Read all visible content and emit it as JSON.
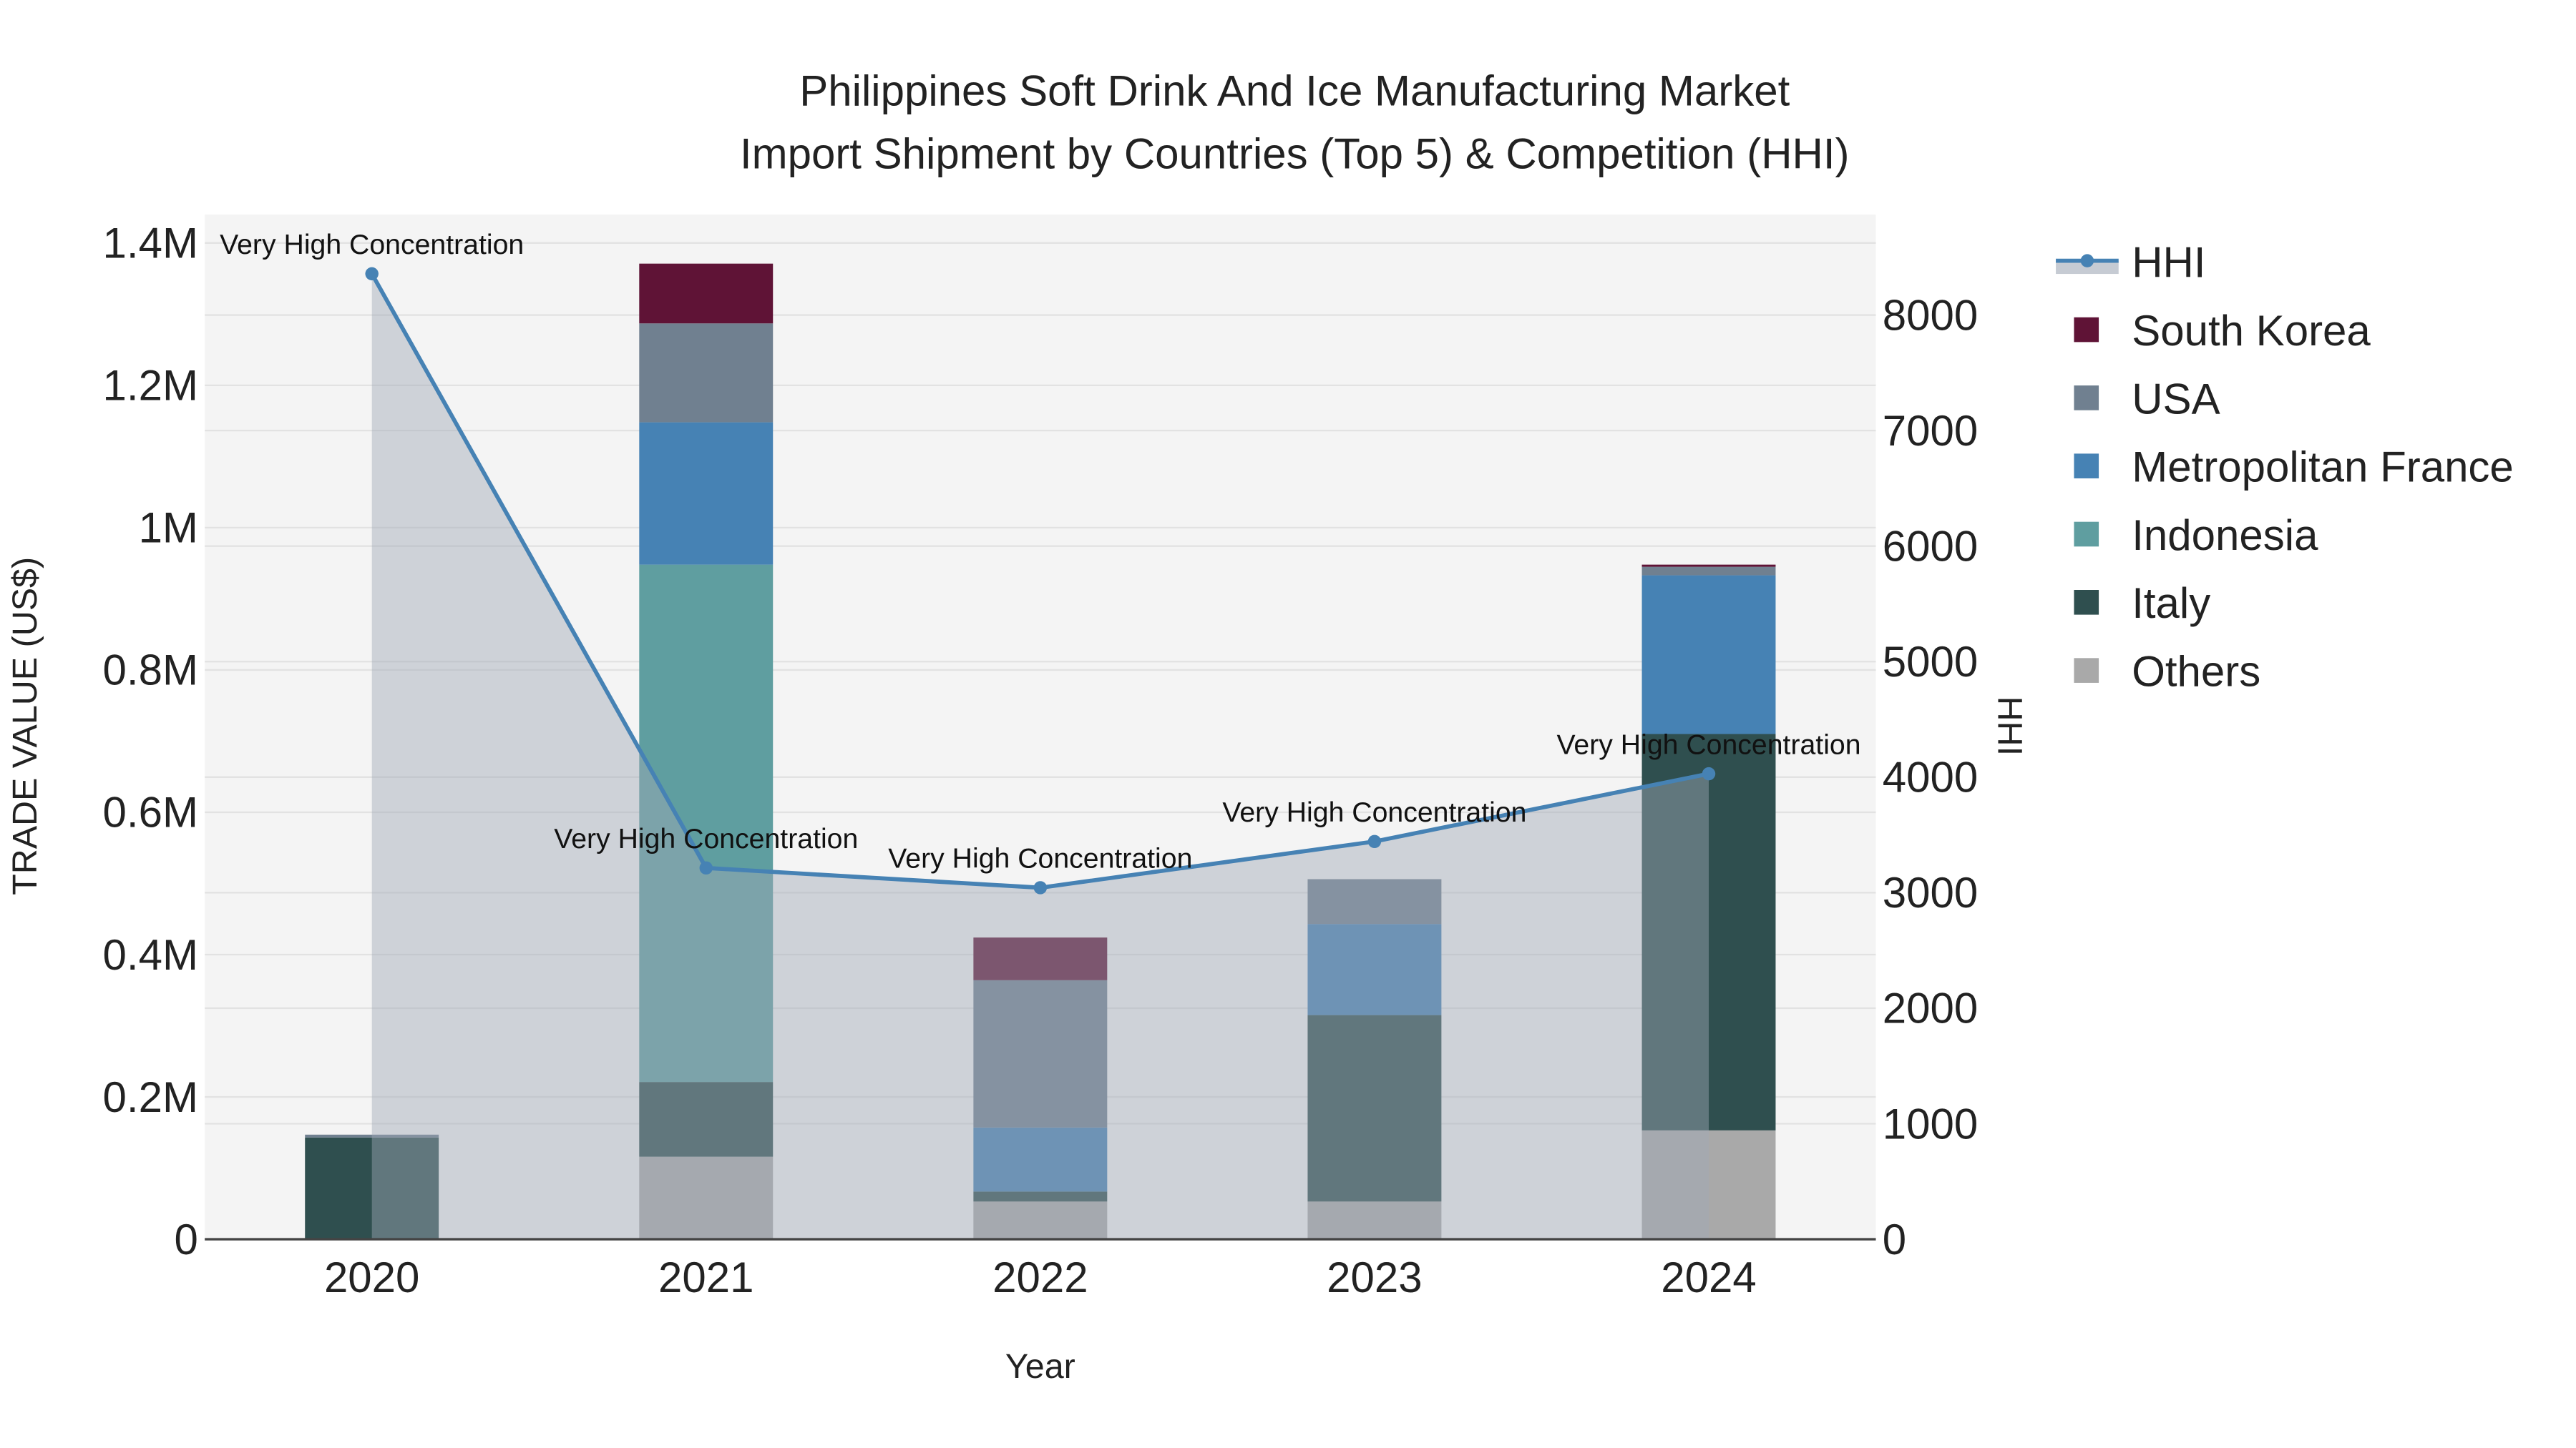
{
  "chart_data": {
    "type": "bar",
    "title_line1": "Philippines Soft Drink And Ice Manufacturing Market",
    "title_line2": "Import Shipment by Countries (Top 5) & Competition (HHI)",
    "xlabel": "Year",
    "ylabel": "TRADE VALUE (US$)",
    "y2label": "HHI",
    "categories": [
      "2020",
      "2021",
      "2022",
      "2023",
      "2024"
    ],
    "ylim": [
      0,
      1440000
    ],
    "y2lim": [
      0,
      8870
    ],
    "yticks": [
      {
        "v": 0,
        "label": "0"
      },
      {
        "v": 200000,
        "label": "0.2M"
      },
      {
        "v": 400000,
        "label": "0.4M"
      },
      {
        "v": 600000,
        "label": "0.6M"
      },
      {
        "v": 800000,
        "label": "0.8M"
      },
      {
        "v": 1000000,
        "label": "1M"
      },
      {
        "v": 1200000,
        "label": "1.2M"
      },
      {
        "v": 1400000,
        "label": "1.4M"
      }
    ],
    "y2ticks": [
      0,
      1000,
      2000,
      3000,
      4000,
      5000,
      6000,
      7000,
      8000
    ],
    "series": [
      {
        "name": "Others",
        "color": "#a9a9a9",
        "values": [
          0,
          116000,
          53000,
          53000,
          153000
        ]
      },
      {
        "name": "Italy",
        "color": "#2f4f4f",
        "values": [
          143000,
          105000,
          14000,
          262000,
          557000
        ]
      },
      {
        "name": "Indonesia",
        "color": "#5f9ea0",
        "values": [
          0,
          727000,
          0,
          0,
          0
        ]
      },
      {
        "name": "Metropolitan France",
        "color": "#4682b4",
        "values": [
          0,
          200000,
          90000,
          128000,
          223000
        ]
      },
      {
        "name": "USA",
        "color": "#708090",
        "values": [
          4000,
          139000,
          207000,
          63000,
          12000
        ]
      },
      {
        "name": "South Korea",
        "color": "#5f1336",
        "values": [
          0,
          84000,
          60000,
          0,
          3000
        ]
      }
    ],
    "hhi": {
      "name": "HHI",
      "color": "#4682b4",
      "values": [
        8357,
        3214,
        3043,
        3443,
        4029
      ],
      "annotations": [
        "Very High Concentration",
        "Very High Concentration",
        "Very High Concentration",
        "Very High Concentration",
        "Very High Concentration"
      ]
    },
    "legend_order": [
      "HHI",
      "South Korea",
      "USA",
      "Metropolitan France",
      "Indonesia",
      "Italy",
      "Others"
    ],
    "legend_position": "right",
    "grid": true
  }
}
